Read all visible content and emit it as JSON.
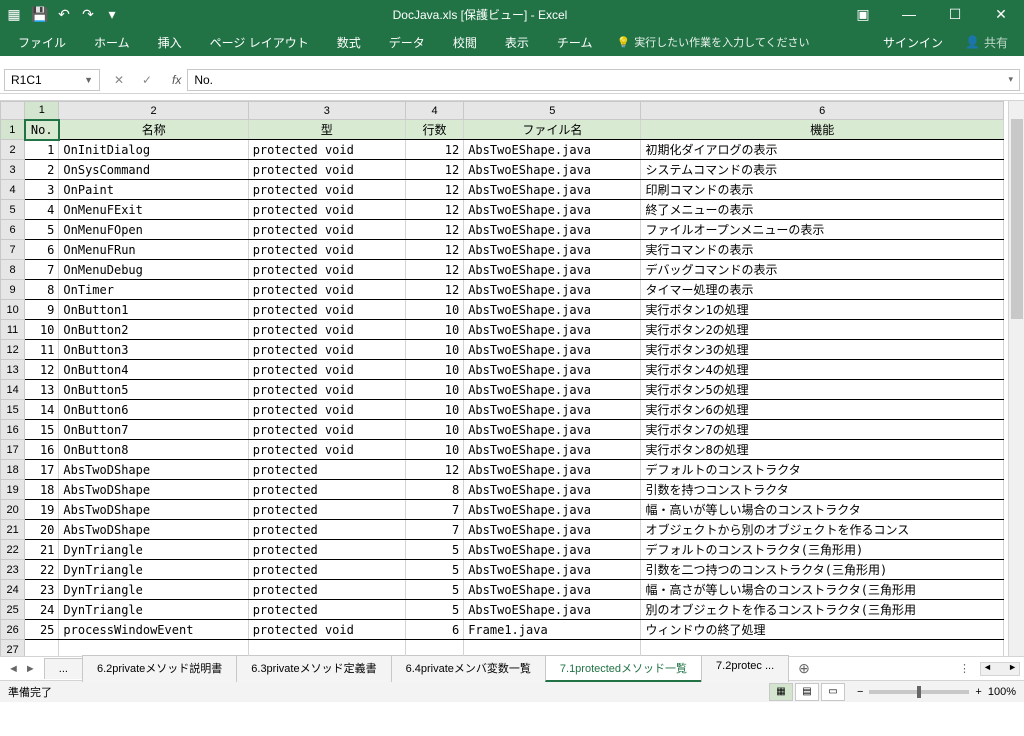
{
  "title": "DocJava.xls  [保護ビュー] - Excel",
  "qat": {
    "save": "💾",
    "undo": "↶",
    "redo": "↷"
  },
  "ribbon": {
    "tabs": [
      "ファイル",
      "ホーム",
      "挿入",
      "ページ レイアウト",
      "数式",
      "データ",
      "校閲",
      "表示",
      "チーム"
    ],
    "tellme": "実行したい作業を入力してください",
    "signin": "サインイン",
    "share": "共有"
  },
  "namebox": "R1C1",
  "formula": "No.",
  "colHeaders": [
    "",
    "1",
    "2",
    "3",
    "4",
    "5",
    "6"
  ],
  "headers": [
    "No.",
    "名称",
    "型",
    "行数",
    "ファイル名",
    "機能"
  ],
  "rows": [
    {
      "no": 1,
      "name": "OnInitDialog",
      "type": "protected void",
      "lines": 12,
      "file": "AbsTwoEShape.java",
      "func": "初期化ダイアログの表示"
    },
    {
      "no": 2,
      "name": "OnSysCommand",
      "type": "protected void",
      "lines": 12,
      "file": "AbsTwoEShape.java",
      "func": "システムコマンドの表示"
    },
    {
      "no": 3,
      "name": "OnPaint",
      "type": "protected void",
      "lines": 12,
      "file": "AbsTwoEShape.java",
      "func": "印刷コマンドの表示"
    },
    {
      "no": 4,
      "name": "OnMenuFExit",
      "type": "protected void",
      "lines": 12,
      "file": "AbsTwoEShape.java",
      "func": "終了メニューの表示"
    },
    {
      "no": 5,
      "name": "OnMenuFOpen",
      "type": "protected void",
      "lines": 12,
      "file": "AbsTwoEShape.java",
      "func": "ファイルオープンメニューの表示"
    },
    {
      "no": 6,
      "name": "OnMenuFRun",
      "type": "protected void",
      "lines": 12,
      "file": "AbsTwoEShape.java",
      "func": "実行コマンドの表示"
    },
    {
      "no": 7,
      "name": "OnMenuDebug",
      "type": "protected void",
      "lines": 12,
      "file": "AbsTwoEShape.java",
      "func": "デバッグコマンドの表示"
    },
    {
      "no": 8,
      "name": "OnTimer",
      "type": "protected void",
      "lines": 12,
      "file": "AbsTwoEShape.java",
      "func": "タイマー処理の表示"
    },
    {
      "no": 9,
      "name": "OnButton1",
      "type": "protected void",
      "lines": 10,
      "file": "AbsTwoEShape.java",
      "func": "実行ボタン1の処理"
    },
    {
      "no": 10,
      "name": "OnButton2",
      "type": "protected void",
      "lines": 10,
      "file": "AbsTwoEShape.java",
      "func": "実行ボタン2の処理"
    },
    {
      "no": 11,
      "name": "OnButton3",
      "type": "protected void",
      "lines": 10,
      "file": "AbsTwoEShape.java",
      "func": "実行ボタン3の処理"
    },
    {
      "no": 12,
      "name": "OnButton4",
      "type": "protected void",
      "lines": 10,
      "file": "AbsTwoEShape.java",
      "func": "実行ボタン4の処理"
    },
    {
      "no": 13,
      "name": "OnButton5",
      "type": "protected void",
      "lines": 10,
      "file": "AbsTwoEShape.java",
      "func": "実行ボタン5の処理"
    },
    {
      "no": 14,
      "name": "OnButton6",
      "type": "protected void",
      "lines": 10,
      "file": "AbsTwoEShape.java",
      "func": "実行ボタン6の処理"
    },
    {
      "no": 15,
      "name": "OnButton7",
      "type": "protected void",
      "lines": 10,
      "file": "AbsTwoEShape.java",
      "func": "実行ボタン7の処理"
    },
    {
      "no": 16,
      "name": "OnButton8",
      "type": "protected void",
      "lines": 10,
      "file": "AbsTwoEShape.java",
      "func": "実行ボタン8の処理"
    },
    {
      "no": 17,
      "name": "AbsTwoDShape",
      "type": "protected",
      "lines": 12,
      "file": "AbsTwoEShape.java",
      "func": "デフォルトのコンストラクタ"
    },
    {
      "no": 18,
      "name": "AbsTwoDShape",
      "type": "protected",
      "lines": 8,
      "file": "AbsTwoEShape.java",
      "func": "引数を持つコンストラクタ"
    },
    {
      "no": 19,
      "name": "AbsTwoDShape",
      "type": "protected",
      "lines": 7,
      "file": "AbsTwoEShape.java",
      "func": "幅・高いが等しい場合のコンストラクタ"
    },
    {
      "no": 20,
      "name": "AbsTwoDShape",
      "type": "protected",
      "lines": 7,
      "file": "AbsTwoEShape.java",
      "func": "オブジェクトから別のオブジェクトを作るコンス"
    },
    {
      "no": 21,
      "name": "DynTriangle",
      "type": "protected",
      "lines": 5,
      "file": "AbsTwoEShape.java",
      "func": "デフォルトのコンストラクタ(三角形用)"
    },
    {
      "no": 22,
      "name": "DynTriangle",
      "type": "protected",
      "lines": 5,
      "file": "AbsTwoEShape.java",
      "func": "引数を二つ持つのコンストラクタ(三角形用)"
    },
    {
      "no": 23,
      "name": "DynTriangle",
      "type": "protected",
      "lines": 5,
      "file": "AbsTwoEShape.java",
      "func": "幅・高さが等しい場合のコンストラクタ(三角形用"
    },
    {
      "no": 24,
      "name": "DynTriangle",
      "type": "protected",
      "lines": 5,
      "file": "AbsTwoEShape.java",
      "func": "別のオブジェクトを作るコンストラクタ(三角形用"
    },
    {
      "no": 25,
      "name": "processWindowEvent",
      "type": "protected void",
      "lines": 6,
      "file": "Frame1.java",
      "func": "ウィンドウの終了処理"
    }
  ],
  "sheetTabs": {
    "ellipsis": "...",
    "tabs": [
      "6.2privateメソッド説明書",
      "6.3privateメソッド定義書",
      "6.4privateメンバ変数一覧",
      "7.1protectedメソッド一覧",
      "7.2protec ..."
    ],
    "active": 3
  },
  "status": {
    "ready": "準備完了",
    "zoom": "100%"
  }
}
